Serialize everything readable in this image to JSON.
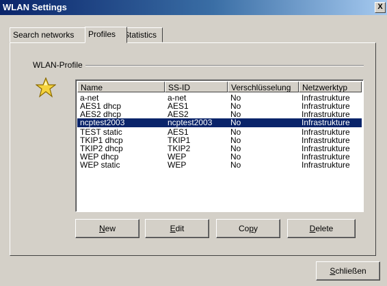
{
  "window": {
    "title": "WLAN Settings",
    "close_glyph": "X"
  },
  "tabs": [
    {
      "label": "Search networks",
      "active": false
    },
    {
      "label": "Profiles",
      "active": true
    },
    {
      "label": "Statistics",
      "active": false
    }
  ],
  "group": {
    "label": "WLAN-Profile",
    "icon": "star-icon"
  },
  "list": {
    "columns": [
      "Name",
      "SS-ID",
      "Verschlüsselung",
      "Netzwerktyp"
    ],
    "rows": [
      {
        "name": "a-net",
        "ssid": "a-net",
        "enc": "No",
        "type": "Infrastrukture",
        "selected": false
      },
      {
        "name": "AES1 dhcp",
        "ssid": "AES1",
        "enc": "No",
        "type": "Infrastrukture",
        "selected": false
      },
      {
        "name": "AES2 dhcp",
        "ssid": "AES2",
        "enc": "No",
        "type": "Infrastrukture",
        "selected": false
      },
      {
        "name": "ncptest2003",
        "ssid": "ncptest2003",
        "enc": "No",
        "type": "Infrastrukture",
        "selected": true
      },
      {
        "name": "TEST static",
        "ssid": "AES1",
        "enc": "No",
        "type": "Infrastrukture",
        "selected": false
      },
      {
        "name": "TKIP1 dhcp",
        "ssid": "TKIP1",
        "enc": "No",
        "type": "Infrastrukture",
        "selected": false
      },
      {
        "name": "TKIP2 dhcp",
        "ssid": "TKIP2",
        "enc": "No",
        "type": "Infrastrukture",
        "selected": false
      },
      {
        "name": "WEP dhcp",
        "ssid": "WEP",
        "enc": "No",
        "type": "Infrastrukture",
        "selected": false
      },
      {
        "name": "WEP static",
        "ssid": "WEP",
        "enc": "No",
        "type": "Infrastrukture",
        "selected": false
      }
    ]
  },
  "buttons": {
    "new": {
      "mnemonic": "N",
      "rest": "ew"
    },
    "edit": {
      "mnemonic": "E",
      "rest": "dit"
    },
    "copy": {
      "pre": "Co",
      "mnemonic": "p",
      "rest": "y"
    },
    "delete": {
      "mnemonic": "D",
      "rest": "elete"
    },
    "close": {
      "mnemonic": "S",
      "rest": "chließen"
    }
  },
  "colors": {
    "selection": "#0a246a",
    "face": "#d4d0c8",
    "titlebar": "#0a246a"
  }
}
